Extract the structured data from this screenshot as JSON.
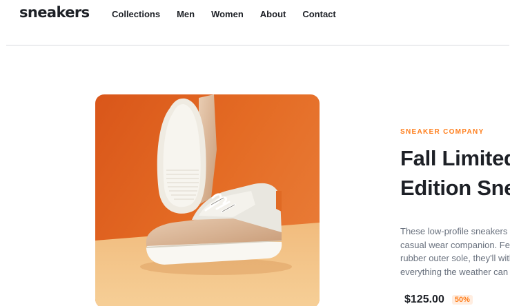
{
  "header": {
    "logo": "sneakers",
    "nav": [
      "Collections",
      "Men",
      "Women",
      "About",
      "Contact"
    ]
  },
  "product": {
    "company": "SNEAKER COMPANY",
    "title_lines": [
      "Fall Limited",
      "Edition Sneakers"
    ],
    "description_lines": [
      "These low-profile sneakers are your perfect",
      "casual wear companion. Featuring a durable",
      "rubber outer sole, they'll withstand",
      "everything the weather can offer."
    ],
    "price": "$125.00",
    "discount": "50%"
  },
  "colors": {
    "accent": "#ff7e1b",
    "accent_light": "#ffede0",
    "text_dark": "#1d2026",
    "text_muted": "#68707d",
    "image_bg_orange": "#e2671f",
    "image_floor": "#f3c28a"
  },
  "image": {
    "icon": "sneaker-product-photo"
  }
}
